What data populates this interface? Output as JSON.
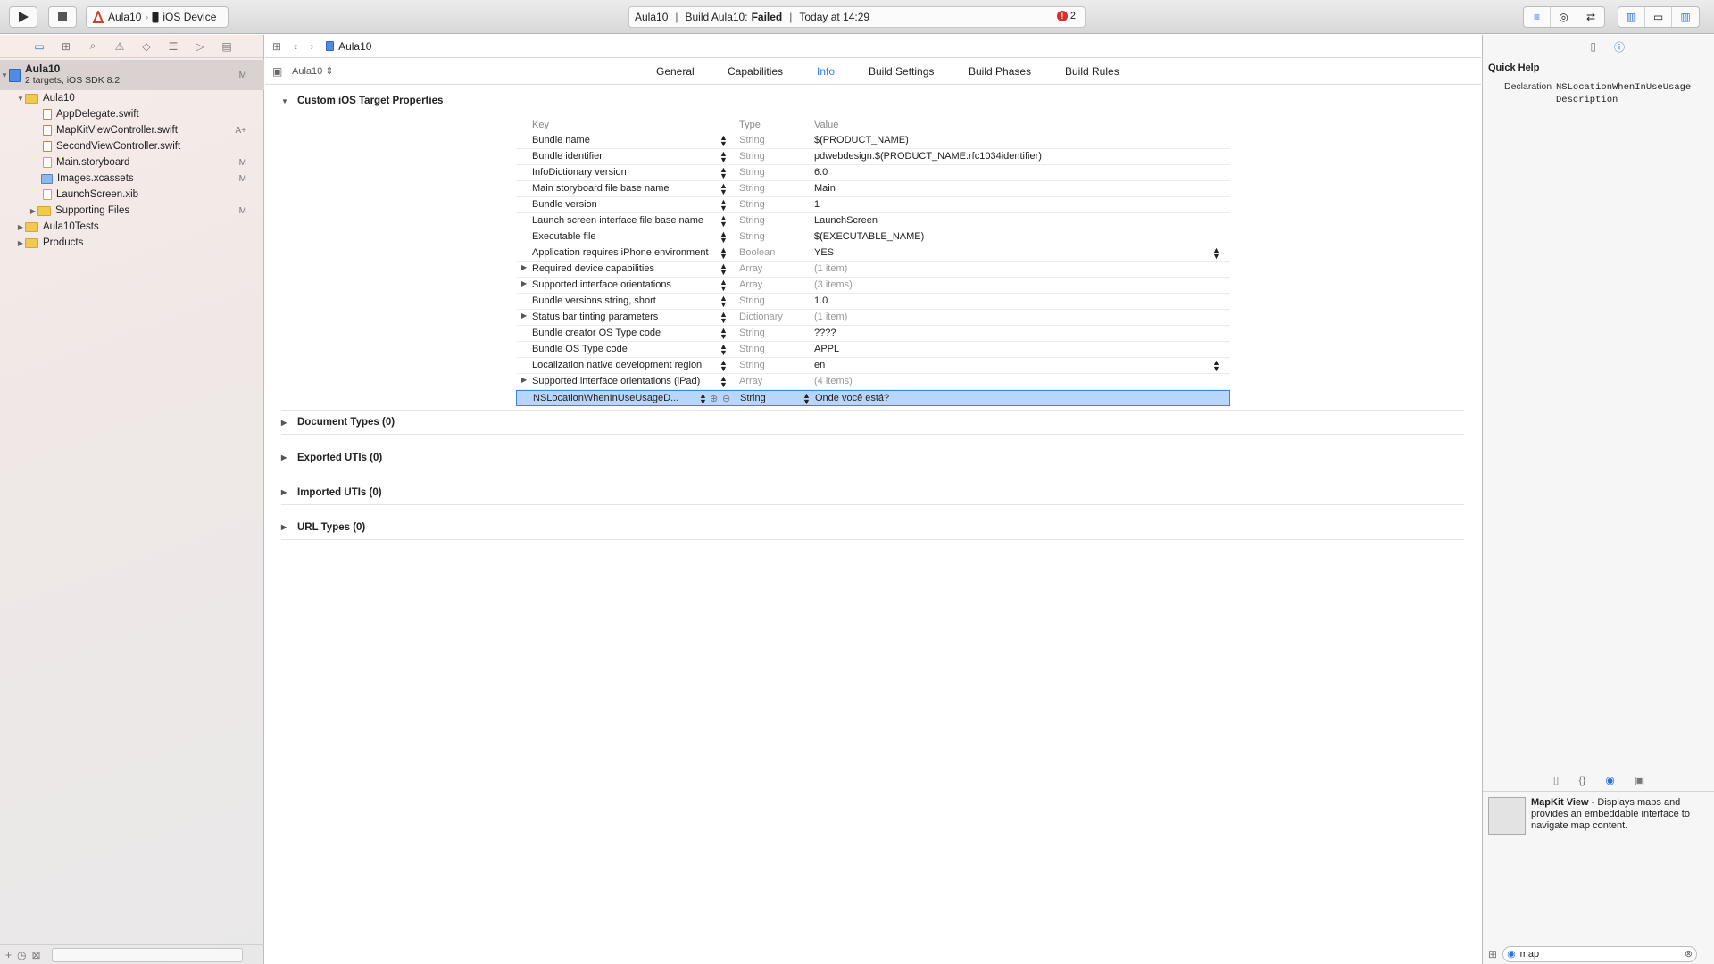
{
  "toolbar": {
    "scheme": "Aula10",
    "destination": "iOS Device",
    "activity": {
      "project": "Aula10",
      "build_label": "Build Aula10:",
      "build_status": "Failed",
      "time": "Today at 14:29",
      "error_count": "2"
    }
  },
  "navigator": {
    "project": {
      "name": "Aula10",
      "subtitle": "2 targets, iOS SDK 8.2",
      "badge": "M"
    },
    "items": [
      {
        "label": "Aula10",
        "kind": "group",
        "expanded": true,
        "badge": ""
      },
      {
        "label": "AppDelegate.swift",
        "kind": "file",
        "badge": ""
      },
      {
        "label": "MapKitViewController.swift",
        "kind": "file",
        "badge": "A+"
      },
      {
        "label": "SecondViewController.swift",
        "kind": "file",
        "badge": ""
      },
      {
        "label": "Main.storyboard",
        "kind": "file",
        "badge": "M"
      },
      {
        "label": "Images.xcassets",
        "kind": "folder",
        "badge": "M"
      },
      {
        "label": "LaunchScreen.xib",
        "kind": "file",
        "badge": ""
      },
      {
        "label": "Supporting Files",
        "kind": "group",
        "expanded": false,
        "badge": "M"
      },
      {
        "label": "Aula10Tests",
        "kind": "group",
        "expanded": false,
        "badge": ""
      },
      {
        "label": "Products",
        "kind": "group",
        "expanded": false,
        "badge": ""
      }
    ]
  },
  "editor": {
    "jump_bar": "Aula10",
    "target": "Aula10",
    "tabs": [
      "General",
      "Capabilities",
      "Info",
      "Build Settings",
      "Build Phases",
      "Build Rules"
    ],
    "active_tab": "Info",
    "plist_section": "Custom iOS Target Properties",
    "columns": {
      "key": "Key",
      "type": "Type",
      "value": "Value"
    },
    "rows": [
      {
        "key": "Bundle name",
        "type": "String",
        "value": "$(PRODUCT_NAME)"
      },
      {
        "key": "Bundle identifier",
        "type": "String",
        "value": "pdwebdesign.$(PRODUCT_NAME:rfc1034identifier)"
      },
      {
        "key": "InfoDictionary version",
        "type": "String",
        "value": "6.0"
      },
      {
        "key": "Main storyboard file base name",
        "type": "String",
        "value": "Main"
      },
      {
        "key": "Bundle version",
        "type": "String",
        "value": "1"
      },
      {
        "key": "Launch screen interface file base name",
        "type": "String",
        "value": "LaunchScreen"
      },
      {
        "key": "Executable file",
        "type": "String",
        "value": "$(EXECUTABLE_NAME)"
      },
      {
        "key": "Application requires iPhone environment",
        "type": "Boolean",
        "value": "YES"
      },
      {
        "key": "Required device capabilities",
        "type": "Array",
        "value": "(1 item)"
      },
      {
        "key": "Supported interface orientations",
        "type": "Array",
        "value": "(3 items)"
      },
      {
        "key": "Bundle versions string, short",
        "type": "String",
        "value": "1.0"
      },
      {
        "key": "Status bar tinting parameters",
        "type": "Dictionary",
        "value": "(1 item)"
      },
      {
        "key": "Bundle creator OS Type code",
        "type": "String",
        "value": "????"
      },
      {
        "key": "Bundle OS Type code",
        "type": "String",
        "value": "APPL"
      },
      {
        "key": "Localization native development region",
        "type": "String",
        "value": "en"
      },
      {
        "key": "Supported interface orientations (iPad)",
        "type": "Array",
        "value": "(4 items)"
      },
      {
        "key": "NSLocationWhenInUseUsageD...",
        "type": "String",
        "value": "Onde você está?"
      }
    ],
    "sections": [
      "Document Types (0)",
      "Exported UTIs (0)",
      "Imported UTIs (0)",
      "URL Types (0)"
    ]
  },
  "inspector": {
    "quick_help_title": "Quick Help",
    "declaration_label": "Declaration",
    "declaration_value": "NSLocationWhenInUseUsage Description",
    "library_item": {
      "name": "MapKit View",
      "description": " - Displays maps and provides an embeddable interface to navigate map content."
    },
    "search_value": "map"
  }
}
